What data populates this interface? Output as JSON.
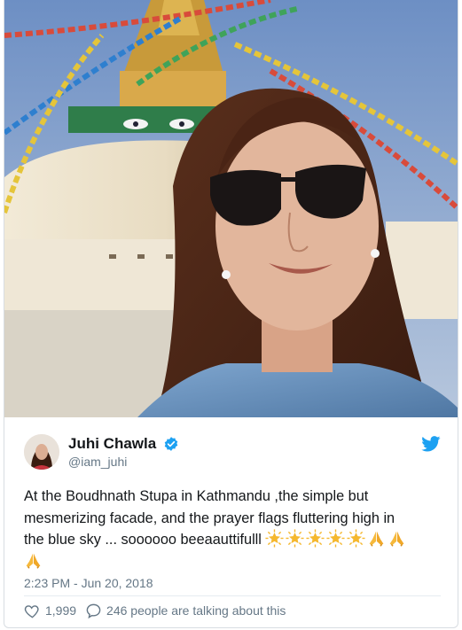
{
  "tweet": {
    "author_name": "Juhi Chawla",
    "author_handle": "@iam_juhi",
    "text_line1": "At the Boudhnath Stupa in Kathmandu ,the simple but",
    "text_line2": "mesmerizing facade, and the prayer flags fluttering high in",
    "text_line3": "the blue sky ... soooooo beeaauttifulll",
    "timestamp": "2:23 PM - Jun 20, 2018",
    "like_count": "1,999",
    "reply_text": "246 people are talking about this",
    "emojis_star_count": 5,
    "emojis_pray_count": 3
  },
  "icons": {
    "verified": "verified-badge-icon",
    "brand": "twitter-bird-icon",
    "like": "heart-icon",
    "reply": "speech-bubble-icon",
    "star": "glowing-star-emoji",
    "pray": "folded-hands-emoji"
  },
  "colors": {
    "brand_blue": "#1da1f2",
    "muted_text": "#657786",
    "star_yellow": "#f5b82e"
  }
}
